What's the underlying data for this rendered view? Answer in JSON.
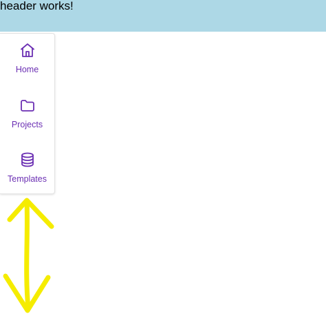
{
  "header": {
    "title": "header works!",
    "background": "#add8e6"
  },
  "sidebar": {
    "accent": "#6b2fb3",
    "items": [
      {
        "label": "Home",
        "icon": "home-icon"
      },
      {
        "label": "Projects",
        "icon": "folder-icon"
      },
      {
        "label": "Templates",
        "icon": "database-icon"
      }
    ]
  },
  "annotation": {
    "icon": "double-headed-arrow",
    "color": "#f5ec00"
  }
}
